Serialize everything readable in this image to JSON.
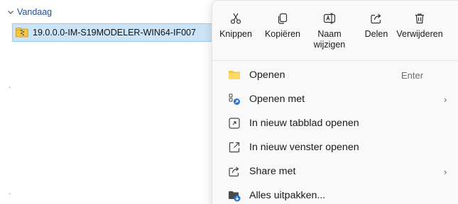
{
  "explorer": {
    "group_label": "Vandaag",
    "file_name": "19.0.0.0-IM-S19MODELER-WIN64-IF007"
  },
  "quick_actions": [
    {
      "label": "Knippen",
      "icon": "scissors-icon"
    },
    {
      "label": "Kopiëren",
      "icon": "copy-icon"
    },
    {
      "label": "Naam wijzigen",
      "icon": "rename-icon"
    },
    {
      "label": "Delen",
      "icon": "share-icon"
    },
    {
      "label": "Verwijderen",
      "icon": "trash-icon"
    }
  ],
  "menu_items": [
    {
      "label": "Openen",
      "shortcut": "Enter",
      "icon": "folder-icon"
    },
    {
      "label": "Openen met",
      "has_submenu": true,
      "icon": "open-with-icon"
    },
    {
      "label": "In nieuw tabblad openen",
      "icon": "new-tab-icon"
    },
    {
      "label": "In nieuw venster openen",
      "icon": "new-window-icon"
    },
    {
      "label": "Share met",
      "has_submenu": true,
      "icon": "share-icon"
    },
    {
      "label": "Alles uitpakken...",
      "icon": "extract-icon"
    }
  ],
  "colors": {
    "selection_bg": "#cce4f7",
    "accent": "#1f4e9c"
  }
}
